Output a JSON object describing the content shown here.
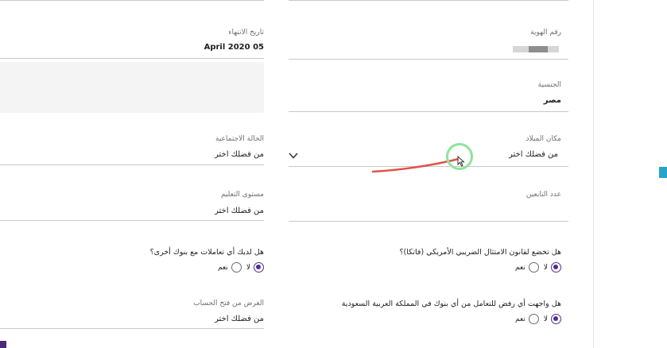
{
  "left_column": {
    "expiry_label": "تاريخ الانتهاء",
    "expiry_value": "April 2020 05",
    "marital_label": "الحالة الاجتماعية",
    "marital_value": "من فضلك اختر",
    "education_label": "مستوى التعليم",
    "education_value": "من فضلك اختر",
    "other_banks_label": "هل لديك أي تعاملات مع بنوك أخرى؟",
    "yes_label": "نعم",
    "no_label": "لا",
    "purpose_label": "الغرض من فتح الحساب",
    "purpose_value": "من فضلك اختر"
  },
  "right_column": {
    "id_number_label": "رقم الهوية",
    "nationality_label": "الجنسية",
    "nationality_value": "مصر",
    "birthplace_label": "مكان الميلاد",
    "birthplace_value": "من فضلك اختر",
    "dependents_label": "عدد التابعين",
    "fatca_label": "هل تخضع لقانون الامتثال الضريبي الأمريكي (فاتكا)؟",
    "yes_label": "نعم",
    "no_label": "لا",
    "rejected_label": "هل واجهت أي رفض للتعامل من أي بنوك في المملكة العربية السعودية",
    "yes_label_2": "نعم",
    "no_label_2": "لا"
  },
  "selections": {
    "other_banks": "لا",
    "fatca": "لا",
    "rejected": "لا"
  },
  "icons": {
    "birthplace_dropdown": "chevron-down-icon",
    "pointer": "cursor-icon"
  },
  "colors": {
    "accent": "#522e8e",
    "edge_tab": "#27a4c9",
    "cursor_ring": "#8ee39a",
    "stroke": "#e0534a"
  }
}
